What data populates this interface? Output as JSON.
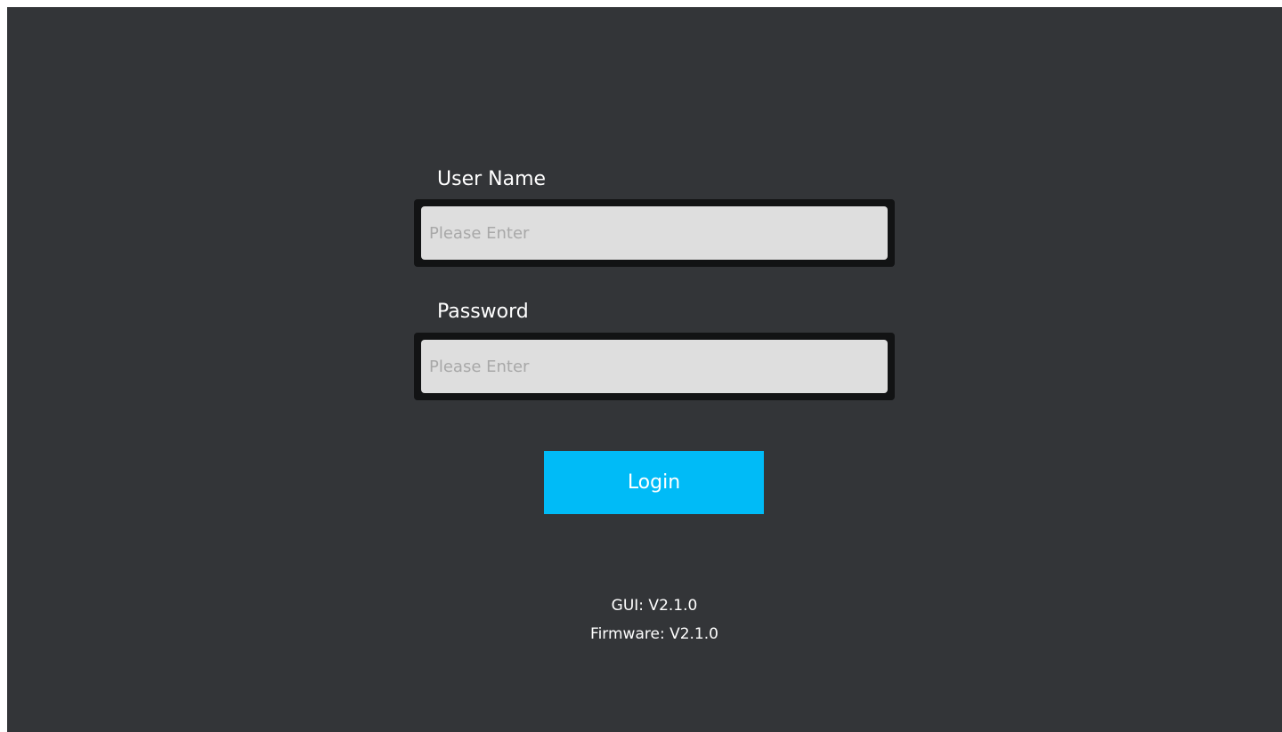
{
  "login_form": {
    "username": {
      "label": "User Name",
      "value": "",
      "placeholder": "Please Enter"
    },
    "password": {
      "label": "Password",
      "value": "",
      "placeholder": "Please Enter"
    },
    "login_button_label": "Login"
  },
  "versions": {
    "gui": "GUI: V2.1.0",
    "firmware": "Firmware: V2.1.0"
  },
  "colors": {
    "background": "#333538",
    "field_frame": "#121314",
    "field_fill": "#dedede",
    "accent": "#00bbf7",
    "text": "#ffffff",
    "placeholder": "#a8a8a8"
  }
}
